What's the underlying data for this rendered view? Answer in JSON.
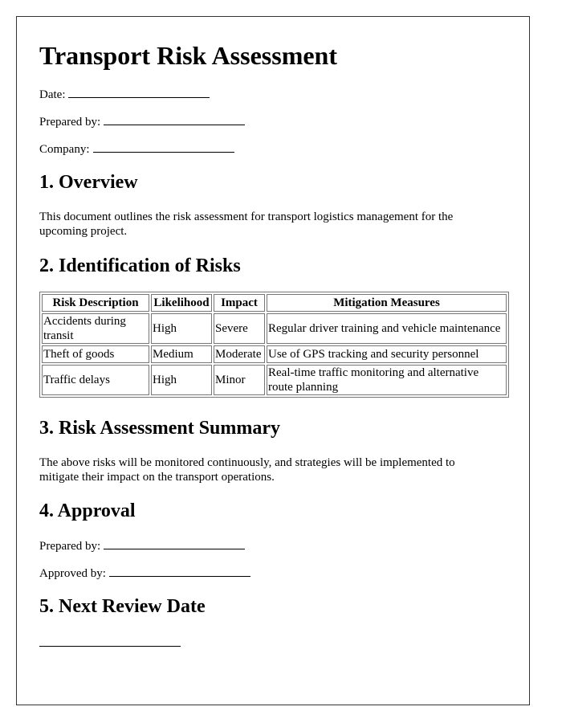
{
  "title": "Transport Risk Assessment",
  "header_fields": [
    {
      "label": "Date:"
    },
    {
      "label": "Prepared by:"
    },
    {
      "label": "Company:"
    }
  ],
  "sections": {
    "overview": {
      "heading": "1. Overview",
      "text": "This document outlines the risk assessment for transport logistics management for the upcoming project."
    },
    "identification": {
      "heading": "2. Identification of Risks",
      "table": {
        "headers": [
          "Risk Description",
          "Likelihood",
          "Impact",
          "Mitigation Measures"
        ],
        "rows": [
          [
            "Accidents during transit",
            "High",
            "Severe",
            "Regular driver training and vehicle maintenance"
          ],
          [
            "Theft of goods",
            "Medium",
            "Moderate",
            "Use of GPS tracking and security personnel"
          ],
          [
            "Traffic delays",
            "High",
            "Minor",
            "Real-time traffic monitoring and alternative route planning"
          ]
        ]
      }
    },
    "summary": {
      "heading": "3. Risk Assessment Summary",
      "text": "The above risks will be monitored continuously, and strategies will be implemented to mitigate their impact on the transport operations."
    },
    "approval": {
      "heading": "4. Approval",
      "fields": [
        {
          "label": "Prepared by:"
        },
        {
          "label": "Approved by:"
        }
      ]
    },
    "next_review": {
      "heading": "5. Next Review Date"
    }
  }
}
